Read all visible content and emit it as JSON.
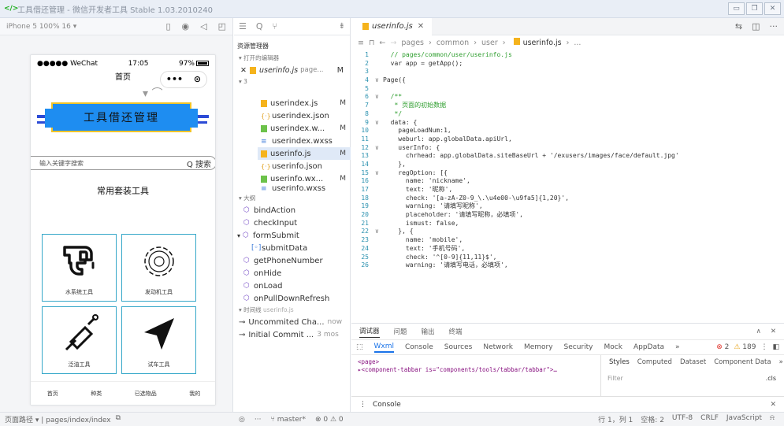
{
  "window": {
    "title": "工具借还管理 - 微信开发者工具 Stable 1.03.2010240"
  },
  "simulator": {
    "device": "iPhone 5 100% 16 ▾",
    "status_carrier": "●●●●● WeChat",
    "status_time": "17:05",
    "status_battery": "97%",
    "nav_title": "首页",
    "banner_title": "工具借还管理",
    "search_placeholder": "输入关键字搜索",
    "search_button": "Q 搜索",
    "section_title": "常用套装工具",
    "tools": [
      {
        "label": "水系统工具",
        "icon": "faucet-icon"
      },
      {
        "label": "发动机工具",
        "icon": "gear-icon"
      },
      {
        "label": "泛油工具",
        "icon": "screwdriver-icon"
      },
      {
        "label": "试车工具",
        "icon": "send-icon"
      }
    ],
    "tabbar": [
      "首页",
      "种类",
      "已选物品",
      "我的"
    ]
  },
  "explorer": {
    "title": "资源管理器",
    "open_editors": "▾ 打开的编辑器",
    "open_file": "userinfo.js",
    "open_file_path": "page...",
    "open_file_status": "M",
    "folder": "▾ 3",
    "files": [
      {
        "name": "userindex.js",
        "type": "js",
        "status": "M"
      },
      {
        "name": "userindex.json",
        "type": "json",
        "status": ""
      },
      {
        "name": "userindex.w...",
        "type": "wxml",
        "status": "M"
      },
      {
        "name": "userindex.wxss",
        "type": "wxss",
        "status": ""
      },
      {
        "name": "userinfo.js",
        "type": "js",
        "status": "M"
      },
      {
        "name": "userinfo.json",
        "type": "json",
        "status": ""
      },
      {
        "name": "userinfo.wx...",
        "type": "wxml",
        "status": "M"
      },
      {
        "name": "userinfo.wxss",
        "type": "wxss",
        "status": ""
      }
    ],
    "outline_header": "▾ 大纲",
    "outline": [
      {
        "name": "bindAction",
        "icon": "method-icon"
      },
      {
        "name": "checkInput",
        "icon": "method-icon"
      },
      {
        "name": "formSubmit",
        "icon": "method-icon"
      },
      {
        "name": "submitData",
        "icon": "variable-icon"
      },
      {
        "name": "getPhoneNumber",
        "icon": "method-icon"
      },
      {
        "name": "onHide",
        "icon": "method-icon"
      },
      {
        "name": "onLoad",
        "icon": "method-icon"
      },
      {
        "name": "onPullDownRefresh",
        "icon": "method-icon"
      }
    ],
    "timeline_header": "▾ 时间线",
    "timeline_file": "userinfo.js",
    "commits": [
      {
        "msg": "Uncommited Cha...",
        "time": "now"
      },
      {
        "msg": "Initial Commit ...",
        "time": "3 mos"
      }
    ]
  },
  "editor": {
    "tab_label": "userinfo.js",
    "breadcrumb": [
      "pages",
      "common",
      "user",
      "userinfo.js",
      "..."
    ],
    "lines": [
      {
        "n": "1",
        "f": "",
        "t": "  // pages/common/user/userinfo.js"
      },
      {
        "n": "2",
        "f": "",
        "t": "  var app = getApp();"
      },
      {
        "n": "3",
        "f": "",
        "t": ""
      },
      {
        "n": "4",
        "f": "∨",
        "t": "Page({"
      },
      {
        "n": "5",
        "f": "",
        "t": ""
      },
      {
        "n": "6",
        "f": "∨",
        "t": "  /**"
      },
      {
        "n": "7",
        "f": "",
        "t": "   * 页面的初始数据"
      },
      {
        "n": "8",
        "f": "",
        "t": "   */"
      },
      {
        "n": "9",
        "f": "∨",
        "t": "  data: {"
      },
      {
        "n": "10",
        "f": "",
        "t": "    pageLoadNum:1,"
      },
      {
        "n": "11",
        "f": "",
        "t": "    weburl: app.globalData.apiUrl,"
      },
      {
        "n": "12",
        "f": "∨",
        "t": "    userInfo: {"
      },
      {
        "n": "13",
        "f": "",
        "t": "      chrhead: app.globalData.siteBaseUrl + '/exusers/images/face/default.jpg'"
      },
      {
        "n": "14",
        "f": "",
        "t": "    },"
      },
      {
        "n": "15",
        "f": "∨",
        "t": "    regOption: [{"
      },
      {
        "n": "16",
        "f": "",
        "t": "      name: 'nickname',"
      },
      {
        "n": "17",
        "f": "",
        "t": "      text: '昵称',"
      },
      {
        "n": "18",
        "f": "",
        "t": "      check: '[a-zA-Z0-9_\\.\\u4e00-\\u9fa5]{1,20}',"
      },
      {
        "n": "19",
        "f": "",
        "t": "      warning: '请填写昵称',"
      },
      {
        "n": "20",
        "f": "",
        "t": "      placeholder: '请填写昵称，必填项',"
      },
      {
        "n": "21",
        "f": "",
        "t": "      ismust: false,"
      },
      {
        "n": "22",
        "f": "∨",
        "t": "    }, {"
      },
      {
        "n": "23",
        "f": "",
        "t": "      name: 'mobile',"
      },
      {
        "n": "24",
        "f": "",
        "t": "      text: '手机号码',"
      },
      {
        "n": "25",
        "f": "",
        "t": "      check: '^[0-9]{11,11}$',"
      },
      {
        "n": "26",
        "f": "",
        "t": "      warning: '请填写电话，必填项',"
      }
    ]
  },
  "debugger": {
    "tabs": [
      "调试器",
      "问题",
      "输出",
      "终端"
    ],
    "devtools": [
      "Wxml",
      "Console",
      "Sources",
      "Network",
      "Memory",
      "Security",
      "Mock",
      "AppData",
      "»"
    ],
    "errors": "2",
    "warnings": "189",
    "element_line1": "<page>",
    "element_line2": "▸<component-tabbar is=\"components/tools/tabbar/tabbar\">…",
    "style_tabs": [
      "Styles",
      "Computed",
      "Dataset",
      "Component Data",
      "»"
    ],
    "filter_placeholder": "Filter",
    "cls": ".cls",
    "console_label": "Console"
  },
  "statusbar": {
    "page_path": "页面路径 ▾ | pages/index/index",
    "branch": "master*",
    "problems": "⊗ 0 ⚠ 0",
    "position": "行 1，列 1",
    "spaces": "空格: 2",
    "encoding": "UTF-8",
    "eol": "CRLF",
    "language": "JavaScript"
  }
}
